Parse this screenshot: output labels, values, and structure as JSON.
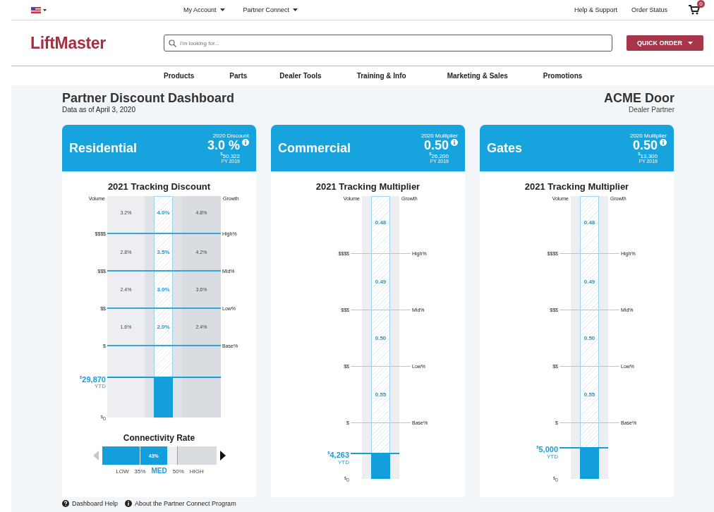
{
  "topbar": {
    "links": [
      {
        "label": "My Account",
        "dropdown": true
      },
      {
        "label": "Partner Connect",
        "dropdown": true
      }
    ],
    "right_links": [
      "Help & Support",
      "Order Status"
    ],
    "cart": {
      "badge": "0"
    }
  },
  "header": {
    "logo": "LiftMaster",
    "search": {
      "placeholder": "I'm looking for..."
    },
    "quick_order": "QUICK ORDER"
  },
  "nav": [
    "Products",
    "Parts",
    "Dealer Tools",
    "Training & Info",
    "Marketing & Sales",
    "Promotions"
  ],
  "page": {
    "title": "Partner Discount Dashboard",
    "subtitle": "Data as of April 3, 2020",
    "dealer": "ACME Door",
    "dealer_role": "Dealer Partner"
  },
  "cards": [
    {
      "name": "Residential",
      "metric_label": "2020 Discount",
      "metric": "3.0 %",
      "prior_currency": "$",
      "prior_amount": "50,322",
      "prior_period": "FY 2019",
      "tracker": {
        "kind": "discount",
        "title": "2021 Tracking Discount",
        "volume_label": "Volume",
        "growth_label": "Growth",
        "bands": [
          {
            "volume": "3.2%",
            "center": "4.0%",
            "growth": "4.8%"
          },
          {
            "volume": "2.8%",
            "center": "3.5%",
            "growth": "4.2%"
          },
          {
            "volume": "2.4%",
            "center": "3.0%",
            "growth": "3.6%"
          },
          {
            "volume": "1.6%",
            "center": "2.0%",
            "growth": "2.4%"
          }
        ],
        "lines": [
          {
            "left": "$$$$",
            "right": "High%"
          },
          {
            "left": "$$$",
            "right": "Mid%"
          },
          {
            "left": "$$",
            "right": "Low%"
          },
          {
            "left": "$",
            "right": "Base%"
          }
        ],
        "zero_currency": "$",
        "zero_amount": "0",
        "ytd_currency": "$",
        "ytd_amount": "29,870",
        "ytd_caption": "YTD",
        "level": 0.18
      },
      "connectivity": {
        "title": "Connectivity Rate",
        "value": "43%",
        "level": 0.57,
        "previous": {
          "disabled": true
        },
        "next": {
          "disabled": false
        },
        "scale": [
          {
            "label": "LOW",
            "kind": "zone",
            "selected": false
          },
          {
            "label": "35%",
            "kind": "tick",
            "selected": false
          },
          {
            "label": "MED",
            "kind": "zone",
            "selected": true
          },
          {
            "label": "50%",
            "kind": "tick",
            "selected": false
          },
          {
            "label": "HIGH",
            "kind": "zone",
            "selected": false
          }
        ]
      }
    },
    {
      "name": "Commercial",
      "metric_label": "2020 Multiplier",
      "metric": "0.50",
      "prior_currency": "$",
      "prior_amount": "26,200",
      "prior_period": "FY 2019",
      "tracker": {
        "kind": "multiplier",
        "title": "2021 Tracking Multiplier",
        "volume_label": "Volume",
        "growth_label": "Growth",
        "bands": [
          {
            "center": "0.48"
          },
          {
            "center": "0.49"
          },
          {
            "center": "0.50"
          },
          {
            "center": "0.55"
          }
        ],
        "lines": [
          {
            "left": "$$$$",
            "right": "High%"
          },
          {
            "left": "$$$",
            "right": "Mid%"
          },
          {
            "left": "$$",
            "right": "Low%"
          },
          {
            "left": "$",
            "right": "Base%"
          }
        ],
        "zero_currency": "$",
        "zero_amount": "0",
        "ytd_currency": "$",
        "ytd_amount": "4,263",
        "ytd_caption": "YTD",
        "level": 0.09
      }
    },
    {
      "name": "Gates",
      "metric_label": "2020 Multiplier",
      "metric": "0.50",
      "prior_currency": "$",
      "prior_amount": "13,300",
      "prior_period": "FY 2019",
      "tracker": {
        "kind": "multiplier",
        "title": "2021 Tracking Multiplier",
        "volume_label": "Volume",
        "growth_label": "Growth",
        "bands": [
          {
            "center": "0.48"
          },
          {
            "center": "0.49"
          },
          {
            "center": "0.50"
          },
          {
            "center": "0.55"
          }
        ],
        "lines": [
          {
            "left": "$$$$",
            "right": "High%"
          },
          {
            "left": "$$$",
            "right": "Mid%"
          },
          {
            "left": "$$",
            "right": "Low%"
          },
          {
            "left": "$",
            "right": "Base%"
          }
        ],
        "zero_currency": "$",
        "zero_amount": "0",
        "ytd_currency": "$",
        "ytd_amount": "5,000",
        "ytd_caption": "YTD",
        "level": 0.11
      }
    }
  ],
  "footer": [
    {
      "label": "Dashboard Help",
      "kind": "help"
    },
    {
      "label": "About the Partner Connect Program",
      "kind": "info"
    }
  ]
}
